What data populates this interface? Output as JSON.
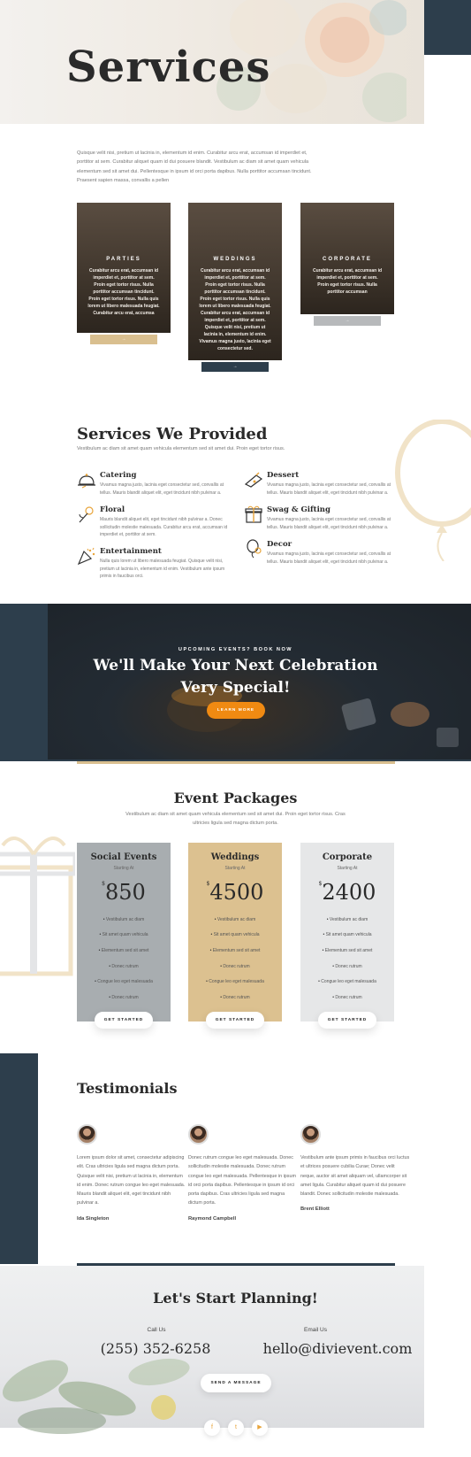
{
  "hero": {
    "title": "Services"
  },
  "intro": "Quisque velit nisi, pretium ut lacinia in, elementum id enim. Curabitur arcu erat, accumsan id imperdiet et, porttitor at sem. Curabitur aliquet quam id dui posuere blandit. Vestibulum ac diam sit amet quam vehicula elementum sed sit amet dui. Pellentesque in ipsum id orci porta dapibus. Nulla porttitor accumsan tincidunt. Praesent sapien massa, convallis a pellen",
  "cards": [
    {
      "title": "PARTIES",
      "text": "Curabitur arcu erat, accumsan id imperdiet et, porttitor at sem. Proin eget tortor risus. Nulla porttitor accumsan tincidunt. Proin eget tortor risus. Nulla quis lorem ut libero malesuada feugiat. Curabitur arcu erat, accumsa",
      "button": "→"
    },
    {
      "title": "WEDDINGS",
      "text": "Curabitur arcu erat, accumsan id imperdiet et, porttitor at sem. Proin eget tortor risus. Nulla porttitor accumsan tincidunt. Proin eget tortor risus. Nulla quis lorem ut libero malesuada feugiat. Curabitur arcu erat, accumsan id imperdiet et, porttitor at sem. Quisque velit nisi, pretium ut lacinia in, elementum id enim. Vivamus magna justo, lacinia eget consectetur sed.",
      "button": "→"
    },
    {
      "title": "CORPORATE",
      "text": "Curabitur arcu erat, accumsan id imperdiet et, porttitor at sem. Proin eget tortor risus. Nulla porttitor accumsan",
      "button": "→"
    }
  ],
  "services_provided": {
    "title": "Services We Provided",
    "subtitle": "Vestibulum ac diam sit amet quam vehicula elementum sed sit amet dui. Proin eget tortor risus.",
    "items": [
      {
        "name": "Catering",
        "icon": "cloche-icon",
        "desc": "Vivamus magna justo, lacinia eget consectetur sed, convallis at tellus. Mauris blandit aliquet elit, eget tincidunt nibh pulvinar a."
      },
      {
        "name": "Dessert",
        "icon": "cake-icon",
        "desc": "Vivamus magna justo, lacinia eget consectetur sed, convallis at tellus. Mauris blandit aliquet elit, eget tincidunt nibh pulvinar a."
      },
      {
        "name": "Floral",
        "icon": "flower-icon",
        "desc": "Mauris blandit aliquet elit, eget tincidunt nibh pulvinar a. Donec sollicitudin molestie malesuada. Curabitur arcu erat, accumsan id imperdiet et, porttitor at sem."
      },
      {
        "name": "Swag & Gifting",
        "icon": "gift-icon",
        "desc": "Vivamus magna justo, lacinia eget consectetur sed, convallis at tellus. Mauris blandit aliquet elit, eget tincidunt nibh pulvinar a."
      },
      {
        "name": "Entertainment",
        "icon": "party-popper-icon",
        "desc": "Nulla quis lorem ut libero malesuada feugiat. Quisque velit nisi, pretium ut lacinia in, elementum id enim. Vestibulum ante ipsum primis in faucibus orci."
      },
      {
        "name": "Decor",
        "icon": "balloon-icon",
        "desc": "Vivamus magna justo, lacinia eget consectetur sed, convallis at tellus. Mauris blandit aliquet elit, eget tincidunt nibh pulvinar a."
      }
    ]
  },
  "cta": {
    "eyebrow": "UPCOMING EVENTS? BOOK NOW",
    "title_line1": "We'll Make Your Next Celebration",
    "title_line2": "Very Special!",
    "button": "LEARN MORE"
  },
  "packages": {
    "title": "Event Packages",
    "subtitle": "Vestibulum ac diam sit amet quam vehicula elementum sed sit amet dui. Proin eget tortor risus. Cras ultricies ligula sed magna dictum porta.",
    "items": [
      {
        "name": "Social Events",
        "starting": "Starting At",
        "currency": "$",
        "price": "850",
        "features": [
          "Vestibulum ac diam",
          "Sit amet quam vehicula",
          "Elementum sed sit amet",
          "Donec rutrum",
          "Congue leo eget malesuada",
          "Donec rutrum"
        ],
        "button": "GET STARTED",
        "color": "#a8adb0"
      },
      {
        "name": "Weddings",
        "starting": "Starting At",
        "currency": "$",
        "price": "4500",
        "features": [
          "Vestibulum ac diam",
          "Sit amet quam vehicula",
          "Elementum sed sit amet",
          "Donec rutrum",
          "Congue leo eget malesuada",
          "Donec rutrum"
        ],
        "button": "GET STARTED",
        "color": "#dcc190"
      },
      {
        "name": "Corporate",
        "starting": "Starting At",
        "currency": "$",
        "price": "2400",
        "features": [
          "Vestibulum ac diam",
          "Sit amet quam vehicula",
          "Elementum sed sit amet",
          "Donec rutrum",
          "Congue leo eget malesuada",
          "Donec rutrum"
        ],
        "button": "GET STARTED",
        "color": "#e6e7e8"
      }
    ]
  },
  "testimonials": {
    "title": "Testimonials",
    "items": [
      {
        "quote": "Lorem ipsum dolor sit amet, consectetur adipiscing elit. Cras ultricies ligula sed magna dictum porta. Quisque velit nisi, pretium ut lacinia in, elementum id enim. Donec rutrum congue leo eget malesuada. Mauris blandit aliquet elit, eget tincidunt nibh pulvinar a.",
        "name": "Ida Singleton"
      },
      {
        "quote": "Donec rutrum congue leo eget malesuada. Donec sollicitudin molestie malesuada. Donec rutrum congue leo eget malesuada. Pellentesque in ipsum id orci porta dapibus. Pellentesque in ipsum id orci porta dapibus. Cras ultricies ligula sed magna dictum porta.",
        "name": "Raymond Campbell"
      },
      {
        "quote": "Vestibulum ante ipsum primis in faucibus orci luctus et ultrices posuere cubilia Curae; Donec velit neque, auctor sit amet aliquam vel, ullamcorper sit amet ligula. Curabitur aliquet quam id dui posuere blandit. Donec sollicitudin molestie malesuada.",
        "name": "Brent Elliott"
      }
    ]
  },
  "contact": {
    "title": "Let's Start Planning!",
    "call_label": "Call Us",
    "phone": "(255) 352-6258",
    "email_label": "Email Us",
    "email": "hello@divievent.com",
    "button": "SEND A MESSAGE",
    "social": [
      {
        "icon": "facebook-icon",
        "glyph": "f"
      },
      {
        "icon": "twitter-icon",
        "glyph": "t"
      },
      {
        "icon": "youtube-icon",
        "glyph": "▶"
      }
    ]
  },
  "colors": {
    "navy": "#2d3e4c",
    "gold": "#d9bf8f",
    "orange": "#f08a12"
  }
}
